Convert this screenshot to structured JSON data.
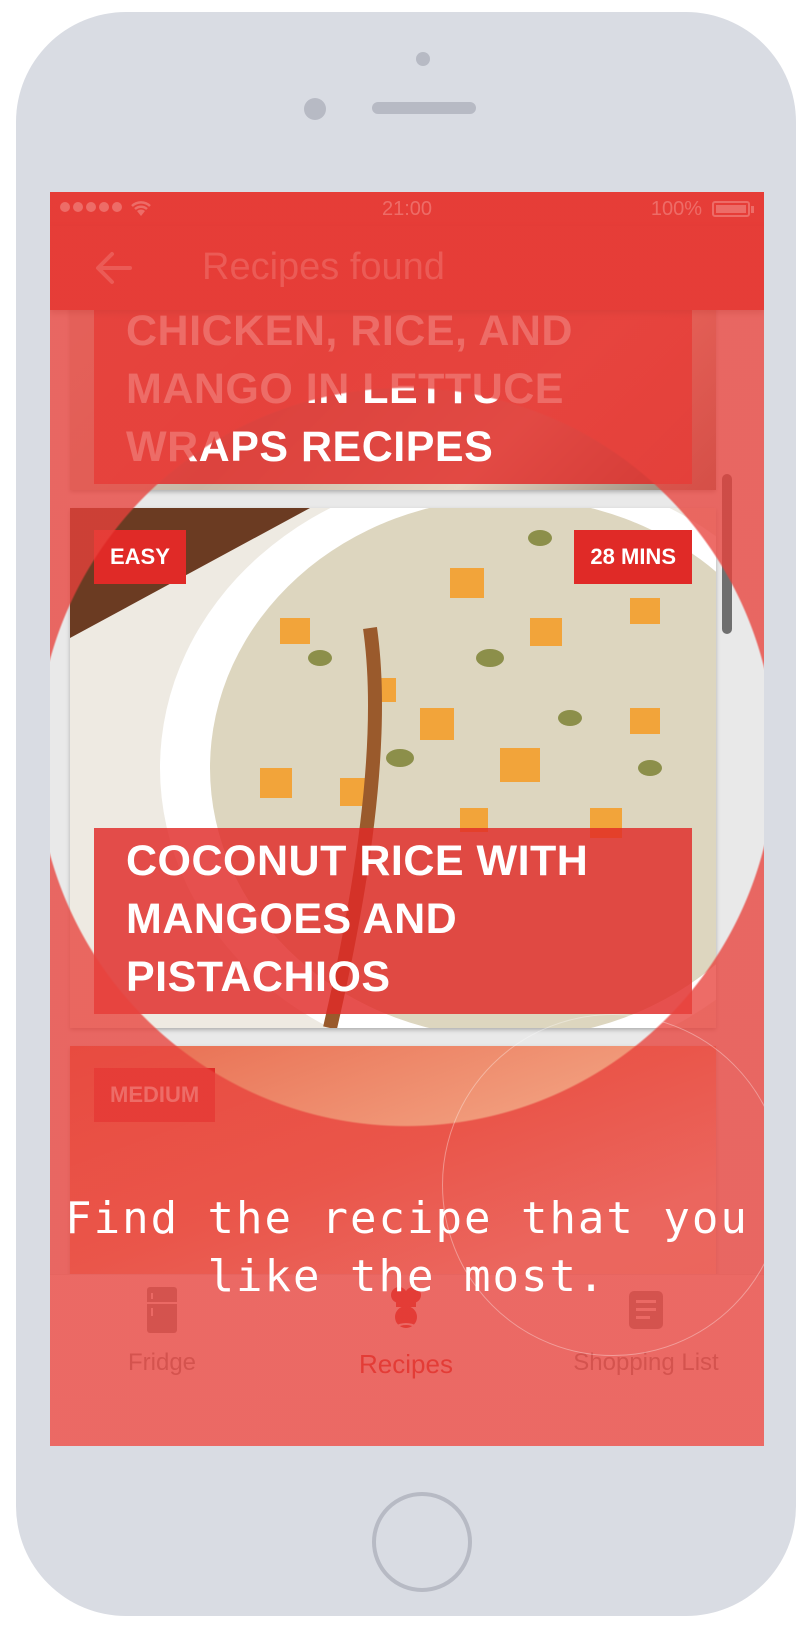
{
  "status_bar": {
    "time": "21:00",
    "battery": "100%"
  },
  "app_bar": {
    "title": "Recipes found"
  },
  "recipes": [
    {
      "title": "CHICKEN, RICE, AND MANGO IN LETTUCE WRAPS RECIPES"
    },
    {
      "title": "COCONUT RICE WITH MANGOES AND PISTACHIOS",
      "difficulty": "EASY",
      "time": "28 MINS"
    },
    {
      "difficulty": "MEDIUM"
    }
  ],
  "bottom_nav": [
    {
      "label": "Fridge",
      "icon": "fridge-icon"
    },
    {
      "label": "Recipes",
      "icon": "chef-icon",
      "active": true
    },
    {
      "label": "Shopping List",
      "icon": "list-icon"
    }
  ],
  "onboarding": {
    "hint": "Find the recipe that you like the most."
  },
  "colors": {
    "primary": "#e02a27",
    "overlay": "#e8423c",
    "phone": "#d9dce3"
  }
}
